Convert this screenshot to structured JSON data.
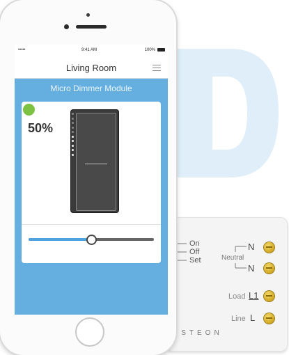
{
  "background": {
    "letters": "D"
  },
  "phone": {
    "status": {
      "time": "9:41 AM",
      "battery": "100%",
      "carrier": "•••••"
    },
    "nav": {
      "title": "Living Room",
      "menu_icon": "hamburger-menu-icon"
    },
    "screen_title": "Micro Dimmer Module",
    "device": {
      "status_color": "#7dc243",
      "level_text": "50%",
      "level": 0.5,
      "led_count": 10
    },
    "accent": "#64aee0"
  },
  "module": {
    "switch_labels": [
      "On",
      "Off",
      "Set"
    ],
    "terminals": {
      "neutral_label": "Neutral",
      "n_top": "N",
      "n_bottom": "N",
      "load_label": "Load",
      "load_terminal": "L1",
      "line_label": "Line",
      "line_terminal": "L"
    },
    "brand": "NSTEON"
  }
}
